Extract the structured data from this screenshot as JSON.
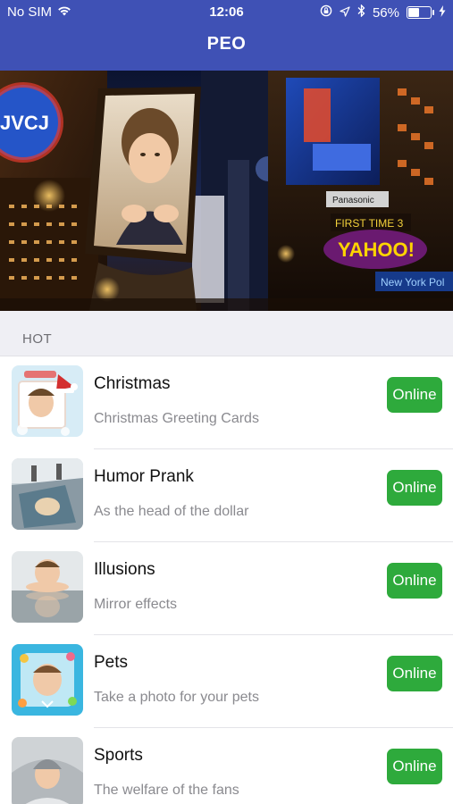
{
  "status_bar": {
    "carrier": "No SIM",
    "time": "12:06",
    "battery_percent": "56%",
    "battery_level": 0.56,
    "icons": [
      "wifi-icon",
      "orientation-lock-icon",
      "location-arrow-icon",
      "bluetooth-icon",
      "battery-icon",
      "charging-icon"
    ]
  },
  "header": {
    "title": "PEO"
  },
  "banner": {
    "description_icons": [
      "times-square-banner"
    ]
  },
  "section": {
    "title": "HOT"
  },
  "items": [
    {
      "name": "Christmas",
      "desc": "Christmas Greeting Cards",
      "button": "Online"
    },
    {
      "name": "Humor Prank",
      "desc": "As the head of the dollar",
      "button": "Online"
    },
    {
      "name": "Illusions",
      "desc": "Mirror effects",
      "button": "Online"
    },
    {
      "name": "Pets",
      "desc": "Take a photo for your pets",
      "button": "Online"
    },
    {
      "name": "Sports",
      "desc": "The welfare of the fans",
      "button": "Online"
    }
  ],
  "colors": {
    "nav": "#3f51b5",
    "button": "#2eaa3c",
    "section_bg": "#efeff4"
  }
}
